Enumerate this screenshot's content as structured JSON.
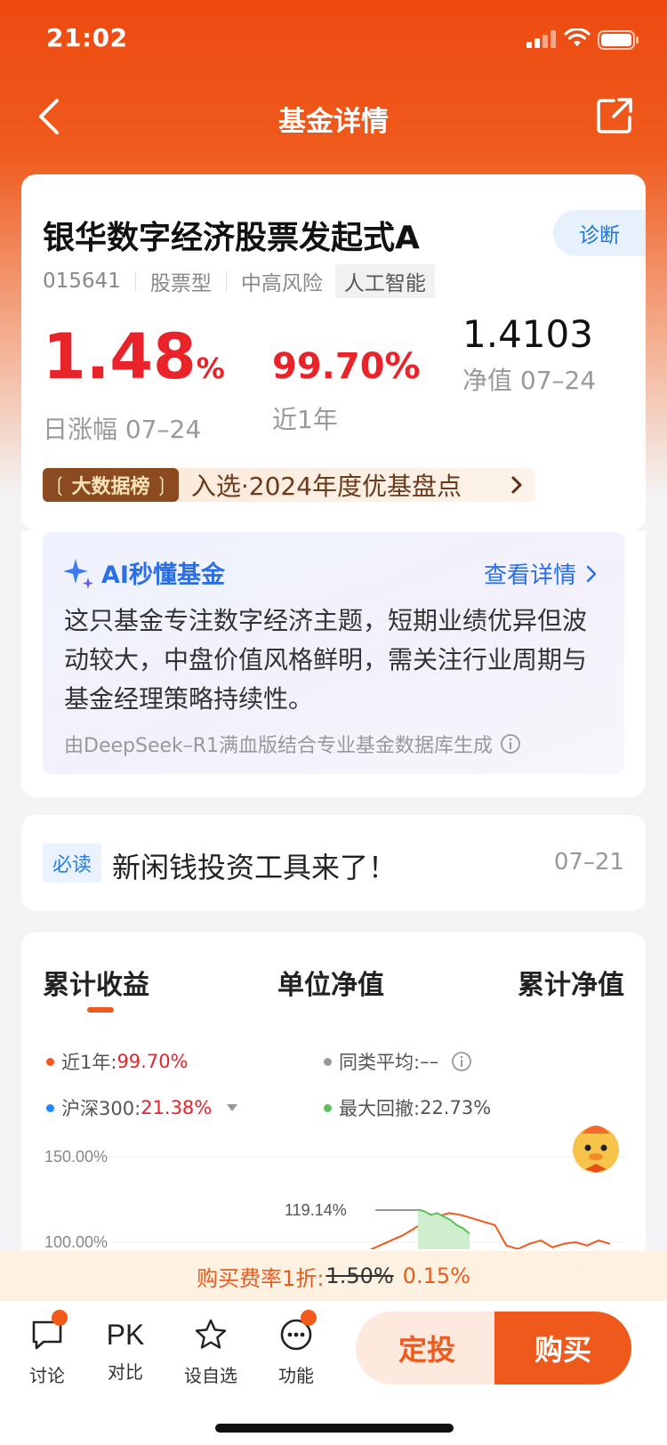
{
  "status_bar": {
    "time": "21:02"
  },
  "nav": {
    "title": "基金详情"
  },
  "fund": {
    "name": "银华数字经济股票发起式A",
    "diagnose_label": "诊断",
    "code": "015641",
    "type": "股票型",
    "risk": "中高风险",
    "theme_tag": "人工智能",
    "daily_change_value": "1.48",
    "daily_change_unit": "%",
    "daily_change_label": "日涨幅 07–24",
    "one_year_value": "99.70%",
    "one_year_label": "近1年",
    "nav_value": "1.4103",
    "nav_label": "净值 07–24",
    "rank_badge": "大数据榜",
    "rank_text": "入选·2024年度优基盘点"
  },
  "ai": {
    "title": "AI秒懂基金",
    "more_label": "查看详情",
    "summary": "这只基金专注数字经济主题，短期业绩优异但波动较大，中盘价值风格鲜明，需关注行业周期与基金经理策略持续性。",
    "footer": "由DeepSeek–R1满血版结合专业基金数据库生成"
  },
  "notice": {
    "tag": "必读",
    "title": "新闲钱投资工具来了！",
    "date": "07–21"
  },
  "chart_tabs": [
    "累计收益",
    "单位净值",
    "累计净值"
  ],
  "legend": {
    "fund_label": "近1年:",
    "fund_value": "99.70%",
    "peer_label": "同类平均:",
    "peer_value": "––",
    "index_label": "沪深300:",
    "index_value": "21.38%",
    "drawdown_label": "最大回撤:",
    "drawdown_value": "22.73%"
  },
  "chart_data": {
    "type": "line",
    "y_ticks": [
      "150.00%",
      "100.00%"
    ],
    "peak_annotation": "119.14%",
    "series": [
      {
        "name": "近1年",
        "color": "#ef5a1c",
        "values": [
          95,
          98,
          101,
          104,
          108,
          112,
          115,
          117,
          116,
          114,
          112,
          110,
          98,
          96,
          99,
          101,
          97,
          99,
          100,
          98,
          101,
          99
        ]
      },
      {
        "name": "最大回撤",
        "color": "#5cbf5a",
        "values": [
          119.14,
          118,
          116,
          117,
          115,
          113,
          110,
          108,
          105
        ]
      }
    ]
  },
  "fee": {
    "prefix": "购买费率1折:",
    "original": "1.50%",
    "discounted": "0.15%"
  },
  "bottom_bar": {
    "discuss": "讨论",
    "pk_icon_text": "PK",
    "pk": "对比",
    "watchlist": "设自选",
    "functions": "功能",
    "invest_plan": "定投",
    "buy": "购买"
  },
  "colors": {
    "brand": "#ef5a1c",
    "up_red": "#e8232a",
    "ai_blue": "#2b6fe6"
  }
}
